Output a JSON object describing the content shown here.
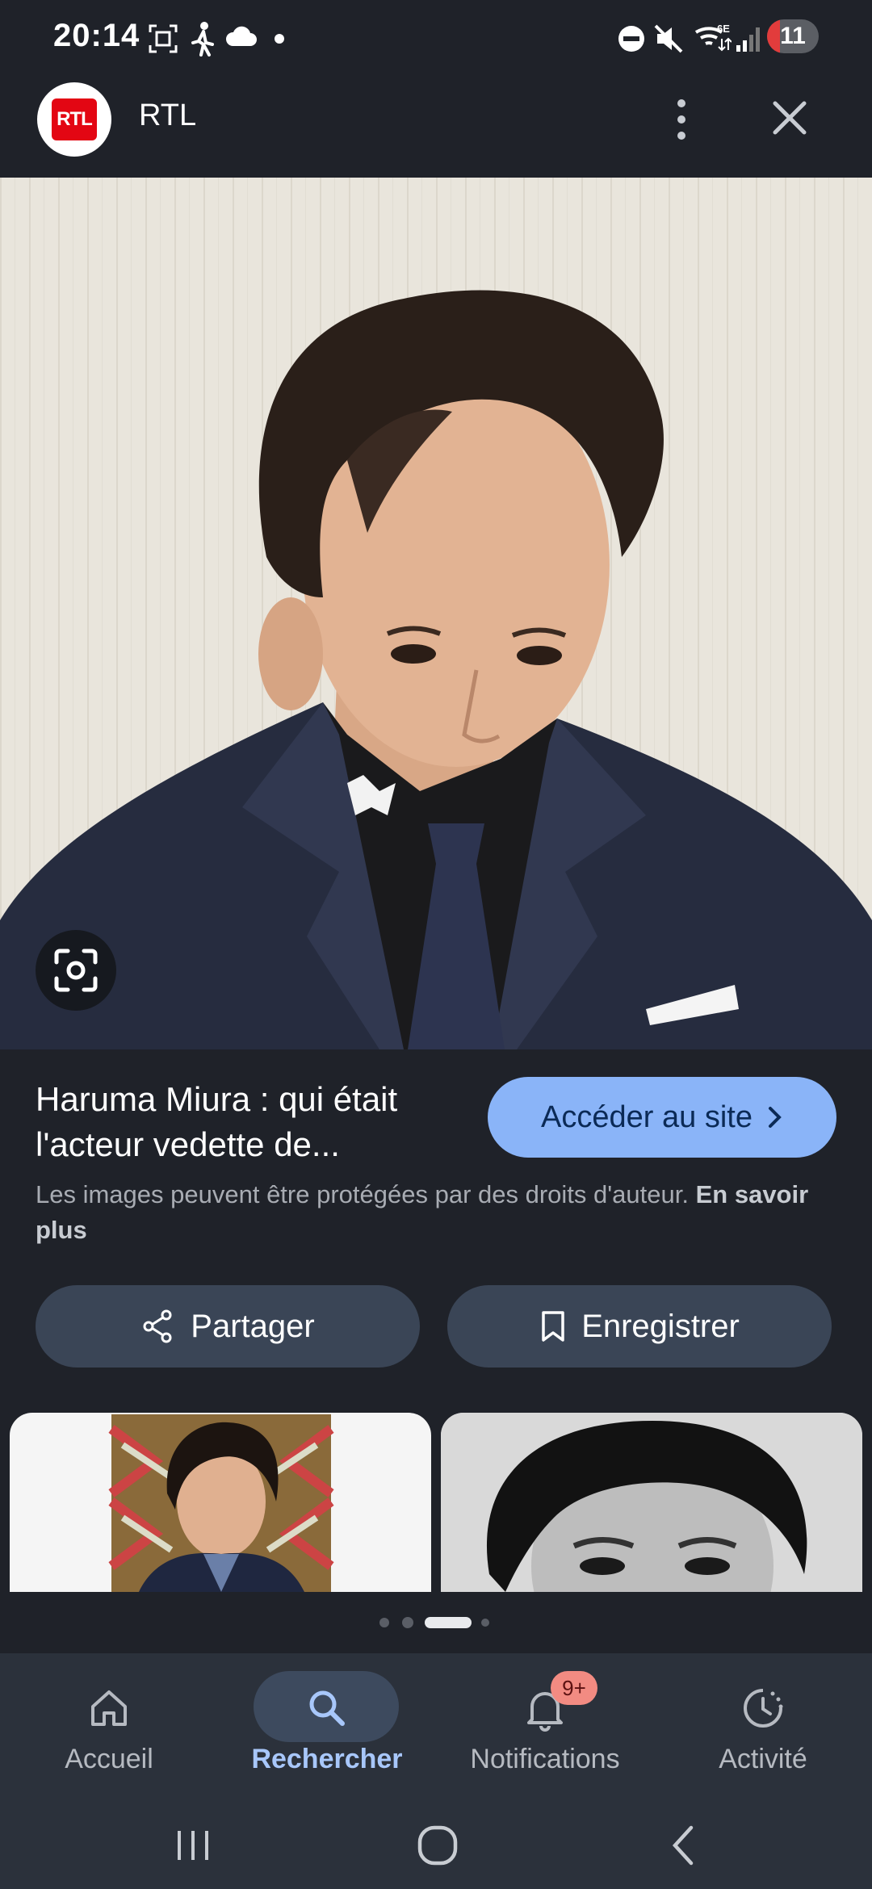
{
  "status_bar": {
    "time": "20:14",
    "battery_level": "11",
    "icons": [
      "screenshot-icon",
      "walking-icon",
      "cloud-icon",
      "dot-icon",
      "dnd-icon",
      "mute-icon",
      "wifi-6e-icon",
      "signal-icon"
    ]
  },
  "header": {
    "logo_text": "RTL",
    "title": "RTL",
    "more_icon": "more-vert-icon",
    "close_icon": "close-icon"
  },
  "result": {
    "title": "Haruma Miura : qui était l'acteur vedette de...",
    "visit_label": "Accéder au site",
    "copyright_text": "Les images peuvent être protégées par des droits d'auteur.",
    "learn_more": "En savoir plus"
  },
  "actions": {
    "share_label": "Partager",
    "save_label": "Enregistrer"
  },
  "pager": {
    "pages": 4,
    "active_index": 2
  },
  "bottom_nav": {
    "items": [
      {
        "label": "Accueil",
        "icon": "home-icon",
        "active": false
      },
      {
        "label": "Rechercher",
        "icon": "search-icon",
        "active": true
      },
      {
        "label": "Notifications",
        "icon": "bell-icon",
        "active": false,
        "badge": "9+"
      },
      {
        "label": "Activité",
        "icon": "activity-icon",
        "active": false
      }
    ]
  },
  "colors": {
    "background": "#1f2229",
    "accent": "#8ab4f8",
    "nav_background": "#2b313b",
    "brand_red": "#e30613"
  }
}
